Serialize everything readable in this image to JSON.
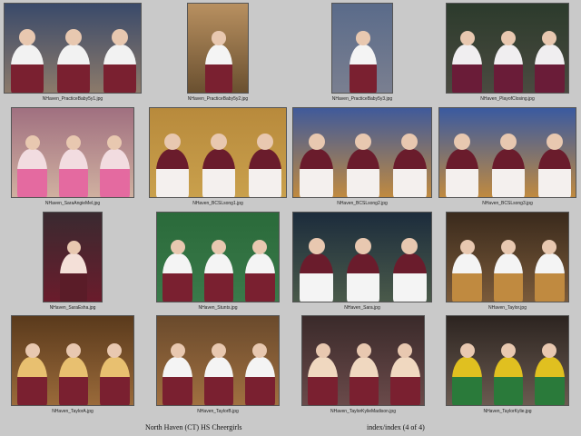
{
  "thumbnails": [
    {
      "caption": "NHaven_PracticeBaby5y1.jpg",
      "palette": [
        "#3a4a6a",
        "#8c7a6a",
        "#f2f2f2",
        "#7a2030"
      ]
    },
    {
      "caption": "NHaven_PracticeBaby5y2.jpg",
      "palette": [
        "#b89060",
        "#6a5030",
        "#f4f4f4",
        "#7a2030"
      ]
    },
    {
      "caption": "NHaven_PracticeBaby5y3.jpg",
      "palette": [
        "#5a6b8a",
        "#7a7f90",
        "#f4f4f4",
        "#7a2030"
      ]
    },
    {
      "caption": "NHaven_PlayofClosing.jpg",
      "palette": [
        "#2c3b2c",
        "#4a4a40",
        "#f0eef0",
        "#6a1c38"
      ]
    },
    {
      "caption": "NHaven_SaraAngieMel.jpg",
      "palette": [
        "#a07080",
        "#d0b0a0",
        "#f2dce0",
        "#e46aa0"
      ]
    },
    {
      "caption": "NHaven_BCSLsong1.jpg",
      "palette": [
        "#b88a3c",
        "#c9a04c",
        "#6a1c2c",
        "#f4f0ee"
      ]
    },
    {
      "caption": "NHaven_BCSLsong2.jpg",
      "palette": [
        "#405a9a",
        "#c08a40",
        "#6a1c2c",
        "#f4f0ee"
      ]
    },
    {
      "caption": "NHaven_BCSLsong3.jpg",
      "palette": [
        "#3a5aa0",
        "#c08a40",
        "#6a1c2c",
        "#f4f0ee"
      ]
    },
    {
      "caption": "NHaven_SaraEsha.jpg",
      "palette": [
        "#3a2a30",
        "#6a1c2c",
        "#f4e0d8",
        "#5a1c28"
      ]
    },
    {
      "caption": "NHaven_Stunts.jpg",
      "palette": [
        "#2a6a3a",
        "#3a7a4a",
        "#f4f4f4",
        "#7a2030"
      ]
    },
    {
      "caption": "NHaven_Sara.jpg",
      "palette": [
        "#1c2c3c",
        "#4a5a4a",
        "#6a1c2c",
        "#f4f4f4"
      ]
    },
    {
      "caption": "NHaven_Taylor.jpg",
      "palette": [
        "#3a2a1c",
        "#7a5a3a",
        "#f4f4f4",
        "#c08a40"
      ]
    },
    {
      "caption": "NHaven_TaylorA.jpg",
      "palette": [
        "#5a3a1c",
        "#9a6a3a",
        "#e8c070",
        "#7a2030"
      ]
    },
    {
      "caption": "NHaven_TaylorB.jpg",
      "palette": [
        "#6a4a2c",
        "#a07040",
        "#f4f4f4",
        "#7a2030"
      ]
    },
    {
      "caption": "NHaven_TaylorKylieMadison.jpg",
      "palette": [
        "#3a2a2a",
        "#6a4a4a",
        "#f0d8c0",
        "#7a2030"
      ]
    },
    {
      "caption": "NHaven_TaylorKylie.jpg",
      "palette": [
        "#2c2420",
        "#6a5a50",
        "#e0c020",
        "#2a7a3a"
      ]
    }
  ],
  "footer": {
    "title": "North Haven (CT) HS Cheergirls",
    "page": "index/index  (4 of 4)"
  }
}
